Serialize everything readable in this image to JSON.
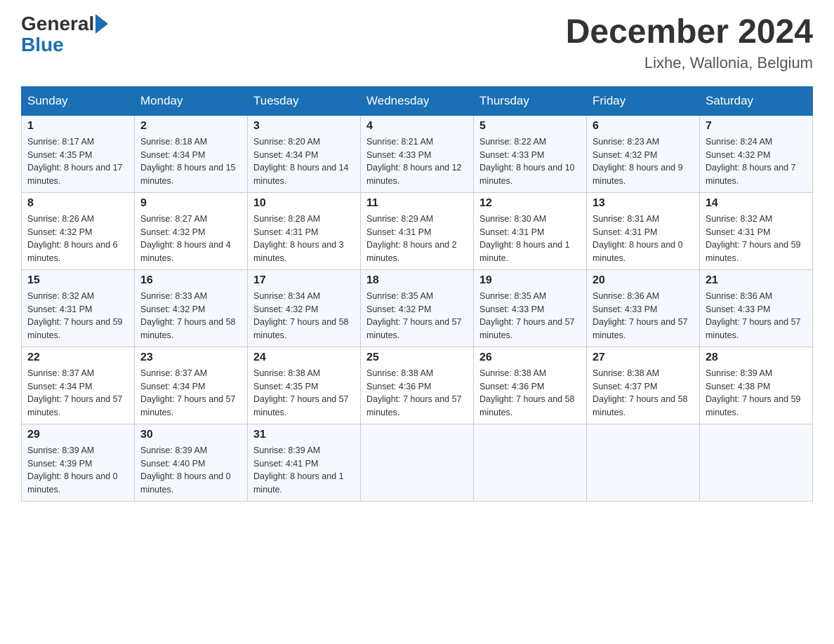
{
  "logo": {
    "general": "General",
    "blue": "Blue"
  },
  "title": "December 2024",
  "subtitle": "Lixhe, Wallonia, Belgium",
  "days_of_week": [
    "Sunday",
    "Monday",
    "Tuesday",
    "Wednesday",
    "Thursday",
    "Friday",
    "Saturday"
  ],
  "weeks": [
    [
      {
        "day": "1",
        "sunrise": "8:17 AM",
        "sunset": "4:35 PM",
        "daylight": "8 hours and 17 minutes."
      },
      {
        "day": "2",
        "sunrise": "8:18 AM",
        "sunset": "4:34 PM",
        "daylight": "8 hours and 15 minutes."
      },
      {
        "day": "3",
        "sunrise": "8:20 AM",
        "sunset": "4:34 PM",
        "daylight": "8 hours and 14 minutes."
      },
      {
        "day": "4",
        "sunrise": "8:21 AM",
        "sunset": "4:33 PM",
        "daylight": "8 hours and 12 minutes."
      },
      {
        "day": "5",
        "sunrise": "8:22 AM",
        "sunset": "4:33 PM",
        "daylight": "8 hours and 10 minutes."
      },
      {
        "day": "6",
        "sunrise": "8:23 AM",
        "sunset": "4:32 PM",
        "daylight": "8 hours and 9 minutes."
      },
      {
        "day": "7",
        "sunrise": "8:24 AM",
        "sunset": "4:32 PM",
        "daylight": "8 hours and 7 minutes."
      }
    ],
    [
      {
        "day": "8",
        "sunrise": "8:26 AM",
        "sunset": "4:32 PM",
        "daylight": "8 hours and 6 minutes."
      },
      {
        "day": "9",
        "sunrise": "8:27 AM",
        "sunset": "4:32 PM",
        "daylight": "8 hours and 4 minutes."
      },
      {
        "day": "10",
        "sunrise": "8:28 AM",
        "sunset": "4:31 PM",
        "daylight": "8 hours and 3 minutes."
      },
      {
        "day": "11",
        "sunrise": "8:29 AM",
        "sunset": "4:31 PM",
        "daylight": "8 hours and 2 minutes."
      },
      {
        "day": "12",
        "sunrise": "8:30 AM",
        "sunset": "4:31 PM",
        "daylight": "8 hours and 1 minute."
      },
      {
        "day": "13",
        "sunrise": "8:31 AM",
        "sunset": "4:31 PM",
        "daylight": "8 hours and 0 minutes."
      },
      {
        "day": "14",
        "sunrise": "8:32 AM",
        "sunset": "4:31 PM",
        "daylight": "7 hours and 59 minutes."
      }
    ],
    [
      {
        "day": "15",
        "sunrise": "8:32 AM",
        "sunset": "4:31 PM",
        "daylight": "7 hours and 59 minutes."
      },
      {
        "day": "16",
        "sunrise": "8:33 AM",
        "sunset": "4:32 PM",
        "daylight": "7 hours and 58 minutes."
      },
      {
        "day": "17",
        "sunrise": "8:34 AM",
        "sunset": "4:32 PM",
        "daylight": "7 hours and 58 minutes."
      },
      {
        "day": "18",
        "sunrise": "8:35 AM",
        "sunset": "4:32 PM",
        "daylight": "7 hours and 57 minutes."
      },
      {
        "day": "19",
        "sunrise": "8:35 AM",
        "sunset": "4:33 PM",
        "daylight": "7 hours and 57 minutes."
      },
      {
        "day": "20",
        "sunrise": "8:36 AM",
        "sunset": "4:33 PM",
        "daylight": "7 hours and 57 minutes."
      },
      {
        "day": "21",
        "sunrise": "8:36 AM",
        "sunset": "4:33 PM",
        "daylight": "7 hours and 57 minutes."
      }
    ],
    [
      {
        "day": "22",
        "sunrise": "8:37 AM",
        "sunset": "4:34 PM",
        "daylight": "7 hours and 57 minutes."
      },
      {
        "day": "23",
        "sunrise": "8:37 AM",
        "sunset": "4:34 PM",
        "daylight": "7 hours and 57 minutes."
      },
      {
        "day": "24",
        "sunrise": "8:38 AM",
        "sunset": "4:35 PM",
        "daylight": "7 hours and 57 minutes."
      },
      {
        "day": "25",
        "sunrise": "8:38 AM",
        "sunset": "4:36 PM",
        "daylight": "7 hours and 57 minutes."
      },
      {
        "day": "26",
        "sunrise": "8:38 AM",
        "sunset": "4:36 PM",
        "daylight": "7 hours and 58 minutes."
      },
      {
        "day": "27",
        "sunrise": "8:38 AM",
        "sunset": "4:37 PM",
        "daylight": "7 hours and 58 minutes."
      },
      {
        "day": "28",
        "sunrise": "8:39 AM",
        "sunset": "4:38 PM",
        "daylight": "7 hours and 59 minutes."
      }
    ],
    [
      {
        "day": "29",
        "sunrise": "8:39 AM",
        "sunset": "4:39 PM",
        "daylight": "8 hours and 0 minutes."
      },
      {
        "day": "30",
        "sunrise": "8:39 AM",
        "sunset": "4:40 PM",
        "daylight": "8 hours and 0 minutes."
      },
      {
        "day": "31",
        "sunrise": "8:39 AM",
        "sunset": "4:41 PM",
        "daylight": "8 hours and 1 minute."
      },
      null,
      null,
      null,
      null
    ]
  ]
}
